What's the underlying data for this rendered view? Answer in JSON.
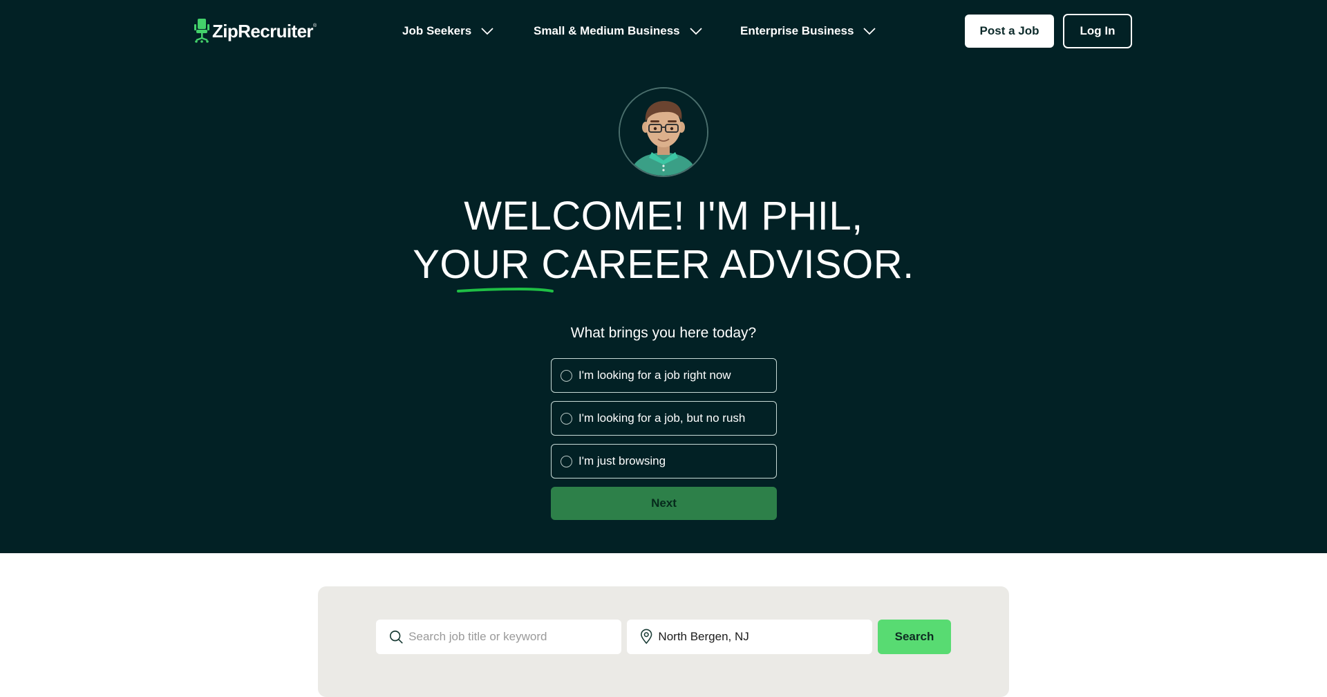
{
  "header": {
    "logo_text": "ZipRecruiter",
    "logo_mark": "®",
    "nav": [
      {
        "label": "Job Seekers",
        "icon": "chevron-down-icon"
      },
      {
        "label": "Small & Medium Business",
        "icon": "chevron-down-icon"
      },
      {
        "label": "Enterprise Business",
        "icon": "chevron-down-icon"
      }
    ],
    "post_job_label": "Post a Job",
    "login_label": "Log In"
  },
  "hero": {
    "avatar_alt": "Phil, career advisor avatar",
    "headline_line1": "WELCOME! I'M PHIL,",
    "headline_line2": "YOUR CAREER ADVISOR.",
    "question": "What brings you here today?",
    "options": [
      {
        "label": "I'm looking for a job right now",
        "selected": false
      },
      {
        "label": "I'm looking for a job, but no rush",
        "selected": false
      },
      {
        "label": "I'm just browsing",
        "selected": false
      }
    ],
    "next_label": "Next"
  },
  "search": {
    "keyword_placeholder": "Search job title or keyword",
    "keyword_value": "",
    "location_value": "North Bergen, NJ",
    "search_label": "Search"
  },
  "colors": {
    "hero_bg": "#022125",
    "brand_green": "#58db72",
    "next_button": "#2d8049",
    "panel_bg": "#ebeae6"
  }
}
